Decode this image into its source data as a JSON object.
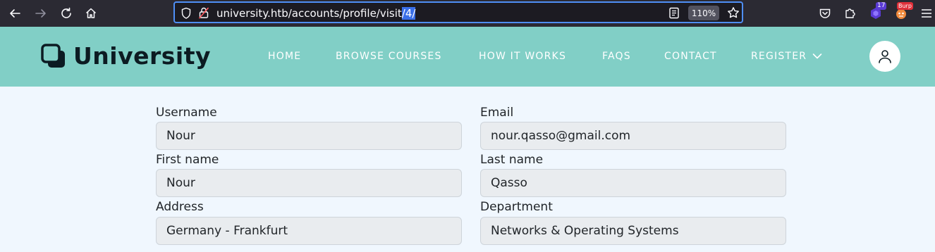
{
  "browser": {
    "url_prefix": "university.htb/accounts/profile/visit",
    "url_selected": "/4/",
    "zoom": "110%",
    "extension_badge_count": "17",
    "burp_badge": "Burp"
  },
  "header": {
    "logo_text": "University",
    "nav": [
      "HOME",
      "BROWSE COURSES",
      "HOW IT WORKS",
      "FAQS",
      "CONTACT",
      "REGISTER"
    ]
  },
  "form": {
    "username_label": "Username",
    "username_value": "Nour",
    "email_label": "Email",
    "email_value": "nour.qasso@gmail.com",
    "first_name_label": "First name",
    "first_name_value": "Nour",
    "last_name_label": "Last name",
    "last_name_value": "Qasso",
    "address_label": "Address",
    "address_value": "Germany - Frankfurt",
    "department_label": "Department",
    "department_value": "Networks & Operating Systems"
  }
}
